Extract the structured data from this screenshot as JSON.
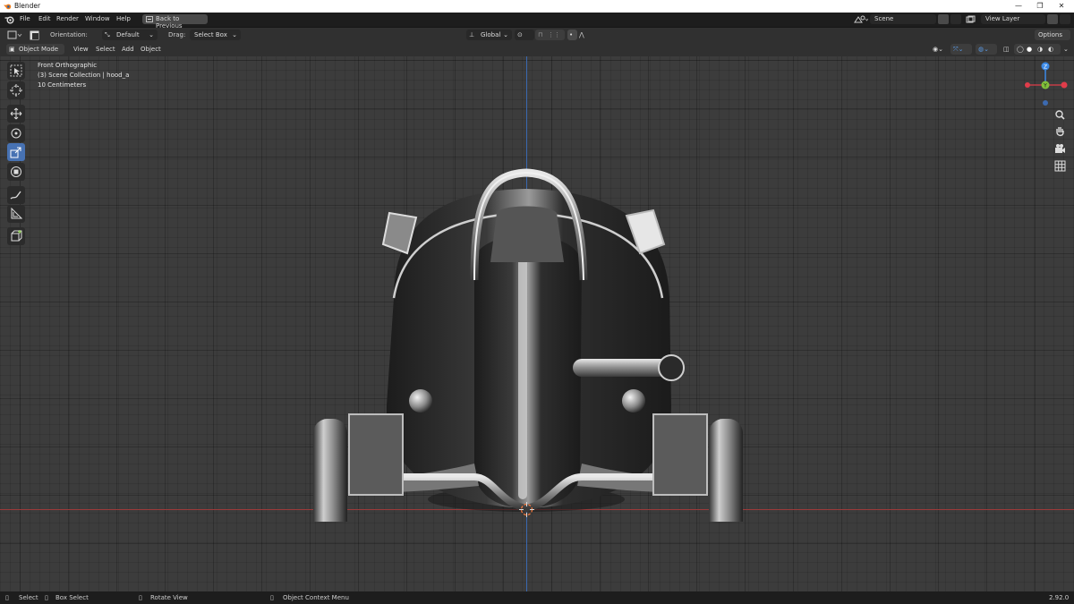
{
  "window": {
    "title": "Blender",
    "controls": [
      "—",
      "❐",
      "✕"
    ]
  },
  "topbar": {
    "menus": [
      "File",
      "Edit",
      "Render",
      "Window",
      "Help"
    ],
    "back_button": "Back to Previous",
    "scene_label": "Scene",
    "view_layer_label": "View Layer"
  },
  "tool_settings": {
    "orientation_label": "Orientation:",
    "orientation_value": "Default",
    "drag_label": "Drag:",
    "drag_value": "Select Box",
    "transform_orientation": "Global",
    "options_label": "Options"
  },
  "viewport_header": {
    "mode": "Object Mode",
    "menus": [
      "View",
      "Select",
      "Add",
      "Object"
    ]
  },
  "viewport": {
    "view_name": "Front Orthographic",
    "collection_info": "(3) Scene Collection | hood_a",
    "scale_info": "10 Centimeters",
    "gizmo": {
      "z": "Z",
      "y": "Y",
      "x_color": "#e03c4a",
      "y_color": "#80c13a",
      "z_color": "#3c8ae6"
    },
    "tools": [
      "cursor-tool",
      "select-tool",
      "move-tool",
      "rotate-tool",
      "scale-tool",
      "transform-tool",
      "annotate-tool",
      "measure-tool",
      "add-cube-tool"
    ]
  },
  "statusbar": {
    "select": "Select",
    "box_select": "Box Select",
    "rotate_view": "Rotate View",
    "context_menu": "Object Context Menu",
    "version": "2.92.0"
  },
  "colors": {
    "accent": "#4772b3",
    "background": "#3c3c3c",
    "header": "#303030",
    "topbar": "#1d1d1d"
  }
}
